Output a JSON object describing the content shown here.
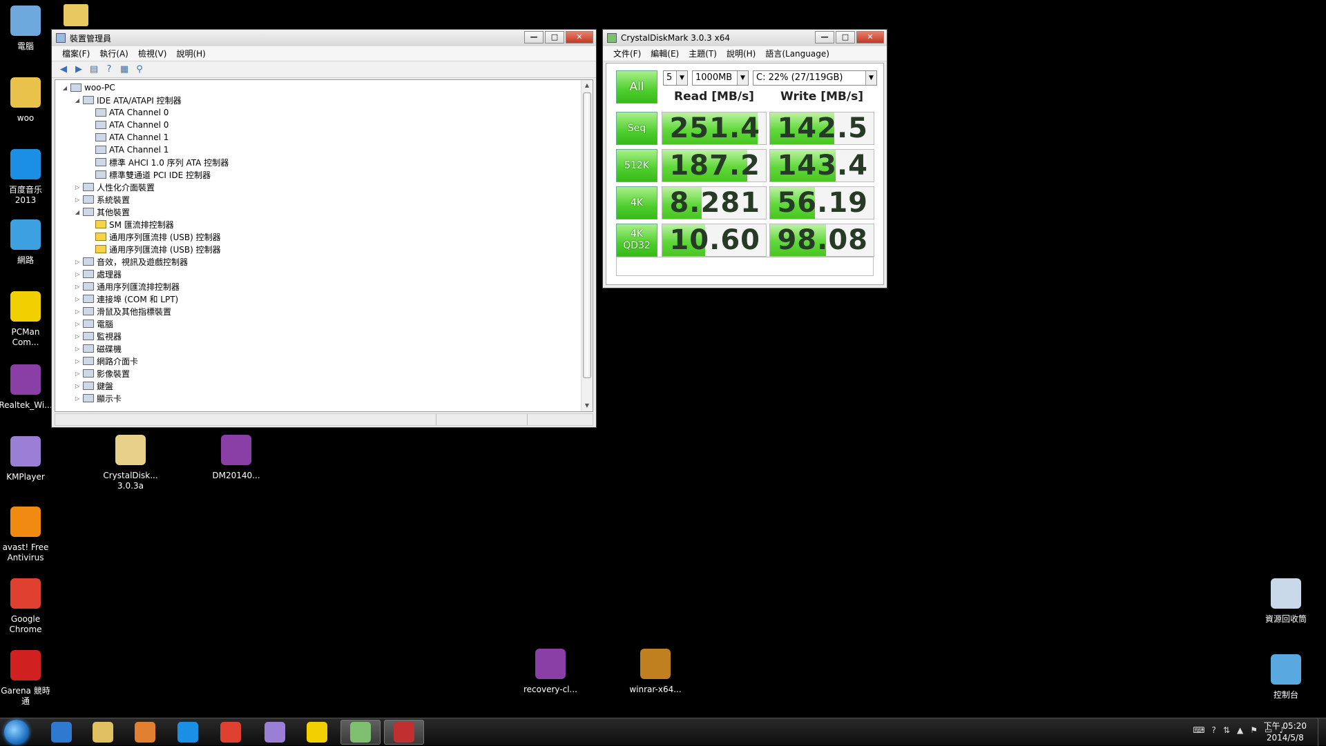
{
  "desktop": {
    "icons_left": [
      {
        "label": "電腦",
        "icon": "computer-icon",
        "color": "#6fa8dc"
      },
      {
        "label": "woo",
        "icon": "user-folder-icon",
        "color": "#e8c24a"
      },
      {
        "label": "百度音乐 2013",
        "icon": "baidu-music-icon",
        "color": "#1a8fe3"
      },
      {
        "label": "網路",
        "icon": "network-icon",
        "color": "#3da0e0"
      },
      {
        "label": "PCMan Com...",
        "icon": "pcman-icon",
        "color": "#f0d000"
      },
      {
        "label": "Realtek_Wi...",
        "icon": "winrar-icon",
        "color": "#8a3fa6"
      },
      {
        "label": "KMPlayer",
        "icon": "kmplayer-icon",
        "color": "#9b7fd4"
      },
      {
        "label": "avast! Free Antivirus",
        "icon": "avast-icon",
        "color": "#f08a10"
      },
      {
        "label": "Google Chrome",
        "icon": "chrome-icon",
        "color": "#e04030"
      },
      {
        "label": "Garena 競時通",
        "icon": "garena-icon",
        "color": "#d02020"
      }
    ],
    "icons_other": [
      {
        "label": "CrystalDisk... 3.0.3a",
        "icon": "folder-icon",
        "color": "#e8d08a"
      },
      {
        "label": "DM20140...",
        "icon": "winrar-icon",
        "color": "#8a3fa6"
      },
      {
        "label": "recovery-cl...",
        "icon": "winrar-icon",
        "color": "#8a3fa6"
      },
      {
        "label": "winrar-x64...",
        "icon": "winrar-setup-icon",
        "color": "#c08020"
      },
      {
        "label": "資源回收筒",
        "icon": "recycle-bin-icon",
        "color": "#c8d8e8"
      },
      {
        "label": "控制台",
        "icon": "control-panel-icon",
        "color": "#5aa8e0"
      }
    ]
  },
  "devmgr": {
    "title": "裝置管理員",
    "menu": [
      "檔案(F)",
      "執行(A)",
      "檢視(V)",
      "說明(H)"
    ],
    "toolbar": [
      "back-icon",
      "forward-icon",
      "properties-icon",
      "help-icon",
      "view-icon",
      "scan-icon"
    ],
    "tree": [
      {
        "label": "woo-PC",
        "level": 0,
        "exp": "◢"
      },
      {
        "label": "IDE ATA/ATAPI 控制器",
        "level": 1,
        "exp": "◢"
      },
      {
        "label": "ATA Channel 0",
        "level": 2,
        "exp": ""
      },
      {
        "label": "ATA Channel 0",
        "level": 2,
        "exp": ""
      },
      {
        "label": "ATA Channel 1",
        "level": 2,
        "exp": ""
      },
      {
        "label": "ATA Channel 1",
        "level": 2,
        "exp": ""
      },
      {
        "label": "標準 AHCI 1.0 序列 ATA 控制器",
        "level": 2,
        "exp": ""
      },
      {
        "label": "標準雙通道 PCI IDE 控制器",
        "level": 2,
        "exp": ""
      },
      {
        "label": "人性化介面裝置",
        "level": 1,
        "exp": "▷"
      },
      {
        "label": "系統裝置",
        "level": 1,
        "exp": "▷"
      },
      {
        "label": "其他裝置",
        "level": 1,
        "exp": "◢"
      },
      {
        "label": "SM 匯流排控制器",
        "level": 2,
        "exp": "",
        "warn": true
      },
      {
        "label": "通用序列匯流排 (USB) 控制器",
        "level": 2,
        "exp": "",
        "warn": true
      },
      {
        "label": "通用序列匯流排 (USB) 控制器",
        "level": 2,
        "exp": "",
        "warn": true
      },
      {
        "label": "音效，視訊及遊戲控制器",
        "level": 1,
        "exp": "▷"
      },
      {
        "label": "處理器",
        "level": 1,
        "exp": "▷"
      },
      {
        "label": "通用序列匯流排控制器",
        "level": 1,
        "exp": "▷"
      },
      {
        "label": "連接埠 (COM 和 LPT)",
        "level": 1,
        "exp": "▷"
      },
      {
        "label": "滑鼠及其他指標裝置",
        "level": 1,
        "exp": "▷"
      },
      {
        "label": "電腦",
        "level": 1,
        "exp": "▷"
      },
      {
        "label": "監視器",
        "level": 1,
        "exp": "▷"
      },
      {
        "label": "磁碟機",
        "level": 1,
        "exp": "▷"
      },
      {
        "label": "網路介面卡",
        "level": 1,
        "exp": "▷"
      },
      {
        "label": "影像裝置",
        "level": 1,
        "exp": "▷"
      },
      {
        "label": "鍵盤",
        "level": 1,
        "exp": "▷"
      },
      {
        "label": "顯示卡",
        "level": 1,
        "exp": "▷"
      }
    ]
  },
  "cdm": {
    "title": "CrystalDiskMark 3.0.3 x64",
    "menu": [
      "文件(F)",
      "編輯(E)",
      "主題(T)",
      "說明(H)",
      "語言(Language)"
    ],
    "all_label": "All",
    "count": "5",
    "size": "1000MB",
    "drive": "C: 22% (27/119GB)",
    "read_header": "Read [MB/s]",
    "write_header": "Write [MB/s]",
    "rows": [
      {
        "label": "Seq",
        "label2": "",
        "read": "251.4",
        "write": "142.5",
        "read_fill": 0.92,
        "write_fill": 0.62
      },
      {
        "label": "512K",
        "label2": "",
        "read": "187.2",
        "write": "143.4",
        "read_fill": 0.82,
        "write_fill": 0.63
      },
      {
        "label": "4K",
        "label2": "",
        "read": "8.281",
        "write": "56.19",
        "read_fill": 0.38,
        "write_fill": 0.43
      },
      {
        "label": "4K",
        "label2": "QD32",
        "read": "10.60",
        "write": "98.08",
        "read_fill": 0.41,
        "write_fill": 0.54
      }
    ],
    "comment": ""
  },
  "taskbar": {
    "items": [
      {
        "icon": "ie-icon",
        "color": "#2f7ad0"
      },
      {
        "icon": "explorer-icon",
        "color": "#e0c060"
      },
      {
        "icon": "media-player-icon",
        "color": "#e08030"
      },
      {
        "icon": "baidu-music-icon",
        "color": "#1a8fe3"
      },
      {
        "icon": "chrome-icon",
        "color": "#e04030"
      },
      {
        "icon": "kmplayer-icon",
        "color": "#9b7fd4"
      },
      {
        "icon": "pcman-icon",
        "color": "#f0d000"
      },
      {
        "icon": "crystaldiskmark-icon",
        "color": "#7fbf70",
        "active": true
      },
      {
        "icon": "device-manager-icon",
        "color": "#c03030",
        "active": true
      }
    ],
    "time": "下午 05:20",
    "date": "2014/5/8"
  }
}
